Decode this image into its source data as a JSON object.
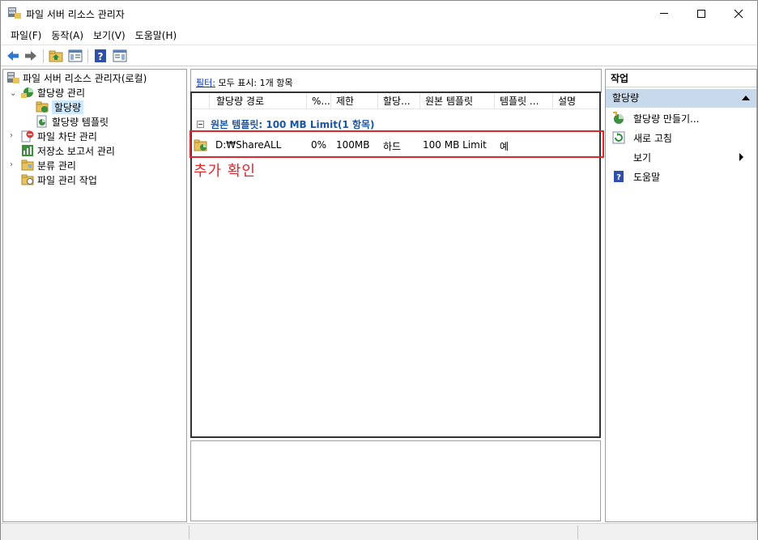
{
  "window": {
    "title": "파일 서버 리소스 관리자",
    "controls": [
      "minimize",
      "maximize",
      "close"
    ]
  },
  "menu": [
    "파일(F)",
    "동작(A)",
    "보기(V)",
    "도움말(H)"
  ],
  "toolbar": {
    "icons": [
      "back-arrow-icon",
      "forward-arrow-icon",
      "up-folder-icon",
      "show-hide-console-tree-icon",
      "help-icon",
      "show-hide-action-pane-icon"
    ]
  },
  "tree": {
    "root": "파일 서버 리소스 관리자(로컬)",
    "quota_mgmt": "할당량 관리",
    "quotas": "할당량",
    "quota_templates": "할당량 템플릿",
    "file_screening": "파일 차단 관리",
    "storage_reports": "저장소 보고서 관리",
    "classification": "분류 관리",
    "file_mgmt_tasks": "파일 관리 작업"
  },
  "center": {
    "filter_label": "필터:",
    "filter_value": "모두 표시: 1개 항목",
    "columns": [
      "할당량 경로",
      "%...",
      "제한",
      "할당...",
      "원본 템플릿",
      "템플릿 ...",
      "설명"
    ],
    "group_label": "원본 템플릿: 100 MB Limit(1 항목)",
    "rows": [
      {
        "path": "D:₩ShareALL",
        "percent": "0%",
        "limit": "100MB",
        "quota_type": "하드",
        "source_template": "100 MB Limit",
        "matches_template": "예",
        "description": ""
      }
    ],
    "annotation": "추가 확인"
  },
  "actions": {
    "title": "작업",
    "group": "할당량",
    "items": [
      "할당량 만들기...",
      "새로 고침",
      "보기",
      "도움말"
    ]
  },
  "colors": {
    "selection": "#cde8ff",
    "action_group_bg": "#c8d9ec",
    "highlight_red": "#e0262a",
    "group_text": "#1a56a6",
    "link": "#0033cc"
  }
}
